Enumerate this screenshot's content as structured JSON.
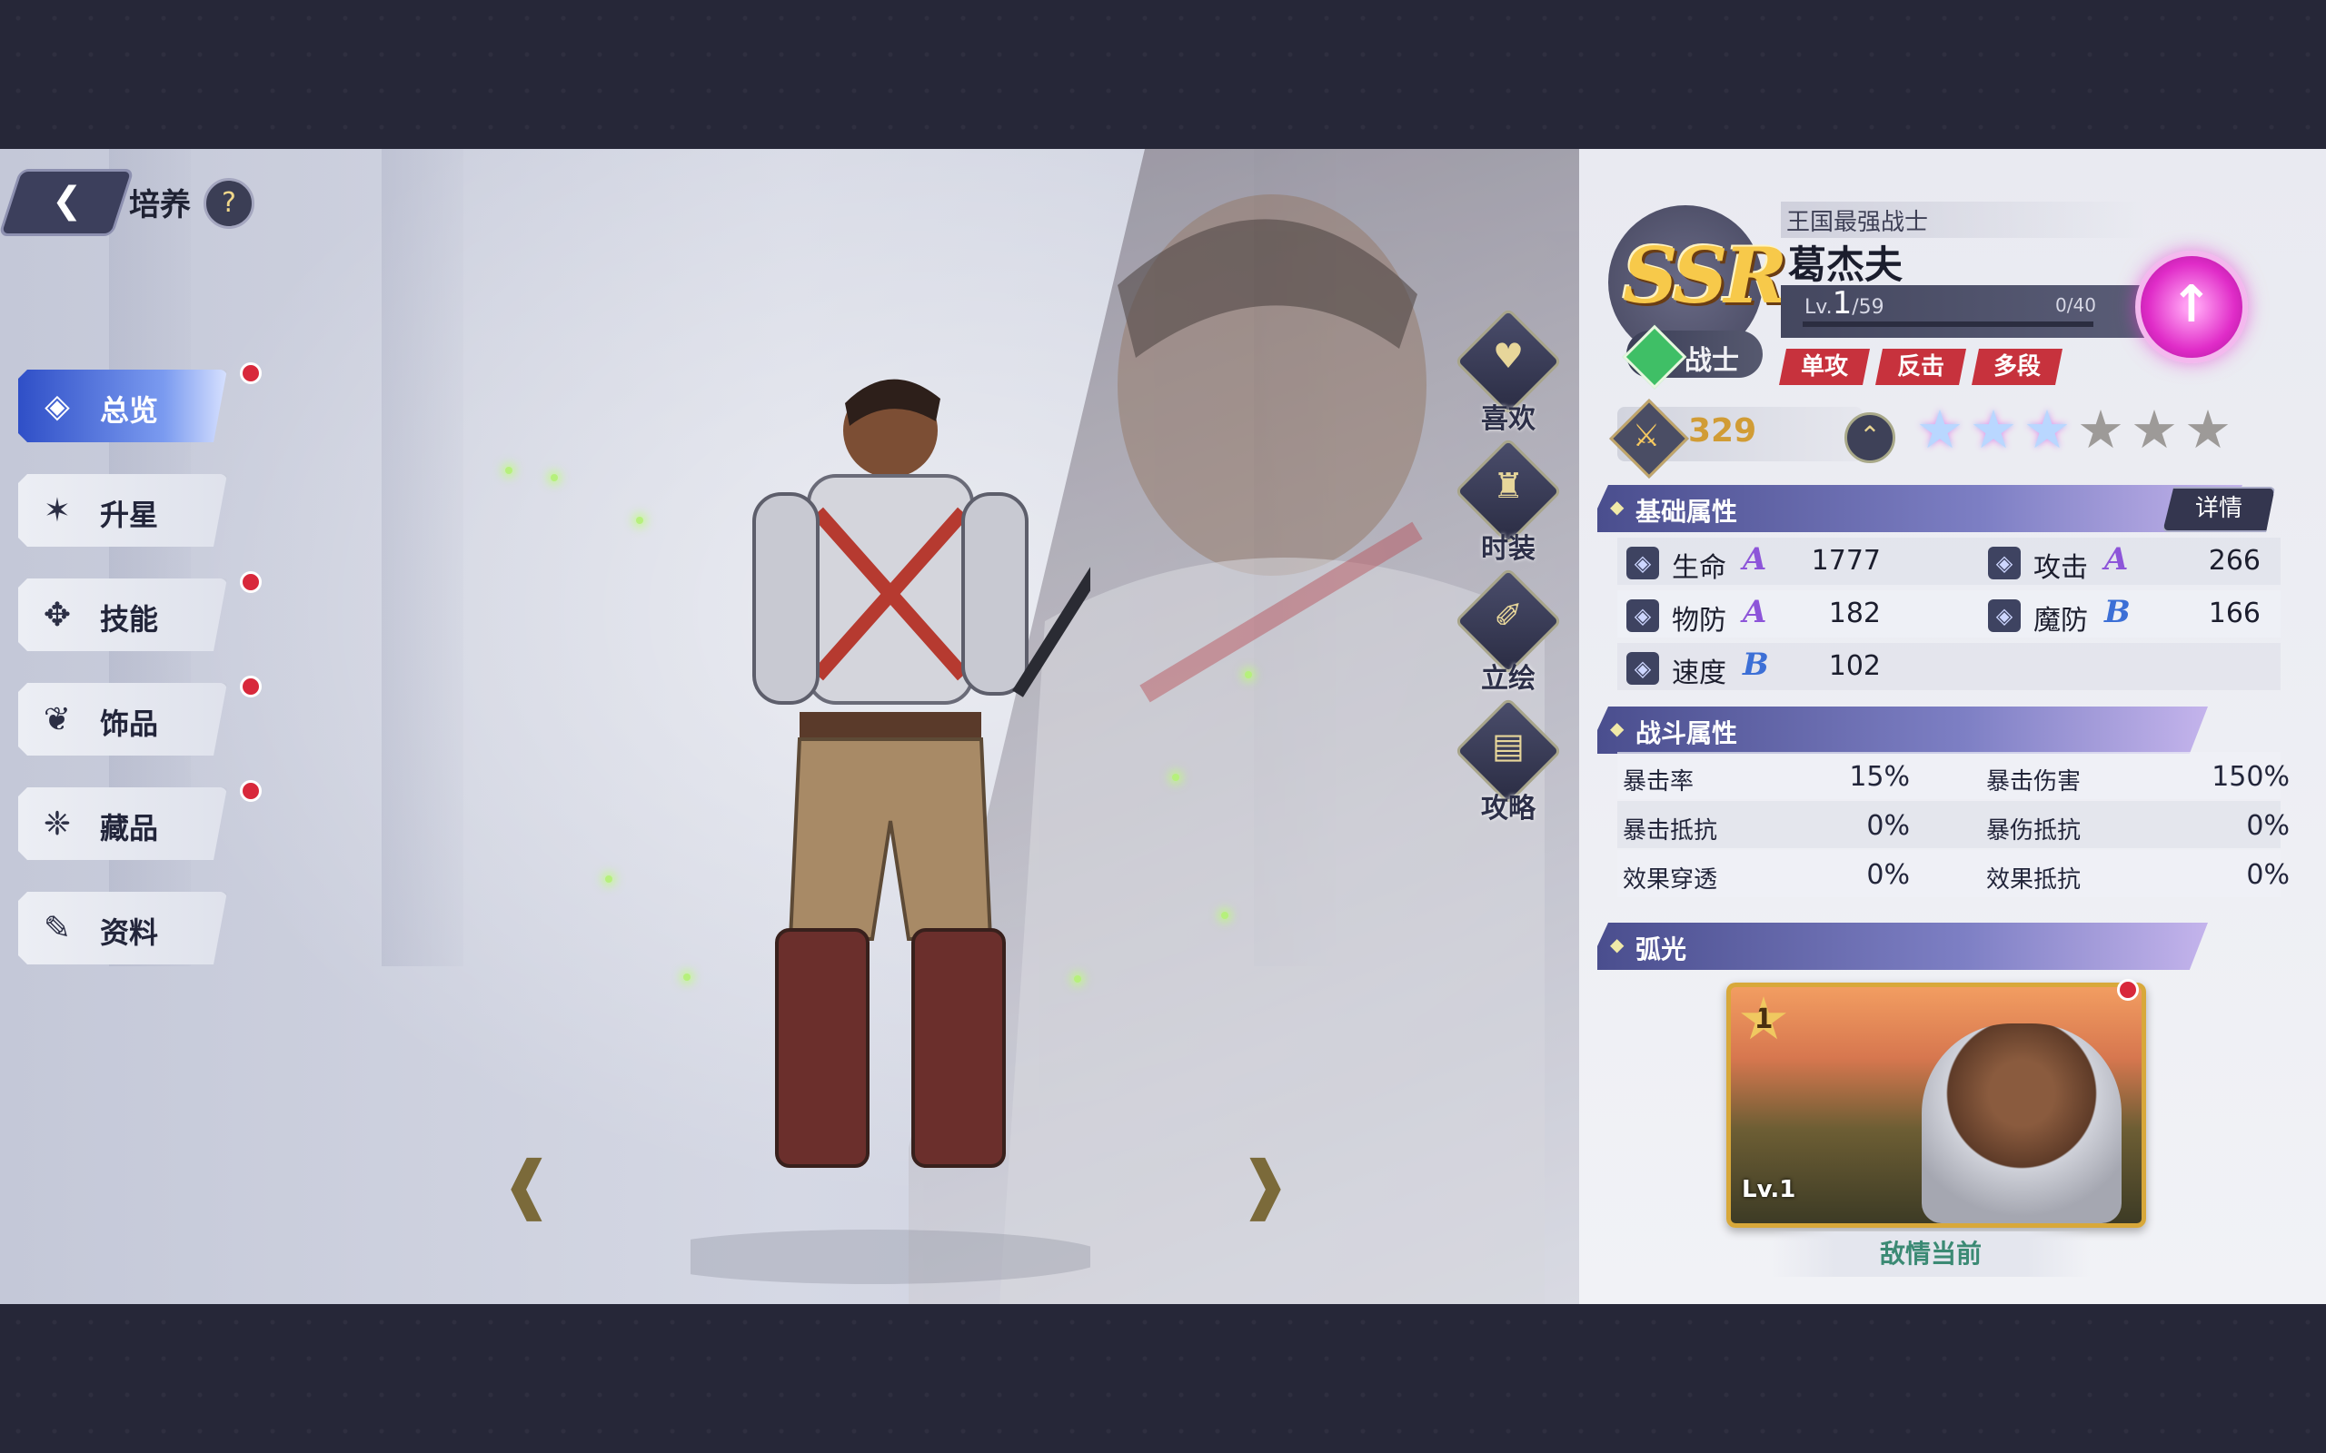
{
  "header": {
    "title": "培养",
    "help_label": "?",
    "back_icon": "back-arrow-icon"
  },
  "menu": [
    {
      "label": "总览",
      "icon": "overview-icon",
      "glyph": "◈",
      "active": true,
      "badge": true
    },
    {
      "label": "升星",
      "icon": "star-upgrade-icon",
      "glyph": "✶",
      "active": false,
      "badge": false
    },
    {
      "label": "技能",
      "icon": "skill-icon",
      "glyph": "✥",
      "active": false,
      "badge": true
    },
    {
      "label": "饰品",
      "icon": "accessory-icon",
      "glyph": "❦",
      "active": false,
      "badge": true
    },
    {
      "label": "藏品",
      "icon": "collection-icon",
      "glyph": "❈",
      "active": false,
      "badge": true
    },
    {
      "label": "资料",
      "icon": "profile-icon",
      "glyph": "✎",
      "active": false,
      "badge": false
    }
  ],
  "side_actions": [
    {
      "label": "喜欢",
      "icon": "heart-icon",
      "glyph": "♥"
    },
    {
      "label": "时装",
      "icon": "costume-icon",
      "glyph": "♜"
    },
    {
      "label": "立绘",
      "icon": "illustration-icon",
      "glyph": "✐"
    },
    {
      "label": "攻略",
      "icon": "guide-book-icon",
      "glyph": "▤"
    }
  ],
  "character": {
    "rarity": "SSR",
    "subtitle": "王国最强战士",
    "name": "葛杰夫",
    "level_prefix": "Lv.",
    "level": "1",
    "level_max": "/59",
    "exp": "0/40",
    "class": "战士",
    "tags": [
      "单攻",
      "反击",
      "多段"
    ],
    "power": "329",
    "stars_total": 6,
    "stars_filled": 3
  },
  "basic_attributes": {
    "title": "基础属性",
    "detail_label": "详情",
    "items": [
      {
        "name": "生命",
        "grade": "A",
        "value": "1777",
        "icon": "hp-icon"
      },
      {
        "name": "攻击",
        "grade": "A",
        "value": "266",
        "icon": "attack-icon"
      },
      {
        "name": "物防",
        "grade": "A",
        "value": "182",
        "icon": "phys-def-icon"
      },
      {
        "name": "魔防",
        "grade": "B",
        "value": "166",
        "icon": "magic-def-icon"
      },
      {
        "name": "速度",
        "grade": "B",
        "value": "102",
        "icon": "speed-icon"
      }
    ]
  },
  "combat_attributes": {
    "title": "战斗属性",
    "items": [
      {
        "name": "暴击率",
        "value": "15%"
      },
      {
        "name": "暴击伤害",
        "value": "150%"
      },
      {
        "name": "暴击抵抗",
        "value": "0%"
      },
      {
        "name": "暴伤抵抗",
        "value": "0%"
      },
      {
        "name": "效果穿透",
        "value": "0%"
      },
      {
        "name": "效果抵抗",
        "value": "0%"
      }
    ]
  },
  "arc": {
    "title": "弧光",
    "rank": "1",
    "level": "Lv.1",
    "caption": "敌情当前"
  },
  "colors": {
    "accent": "#7d7fc4",
    "badge": "#d8283b",
    "upgrade": "#e02cc8",
    "ssr": "#f7c94a"
  }
}
